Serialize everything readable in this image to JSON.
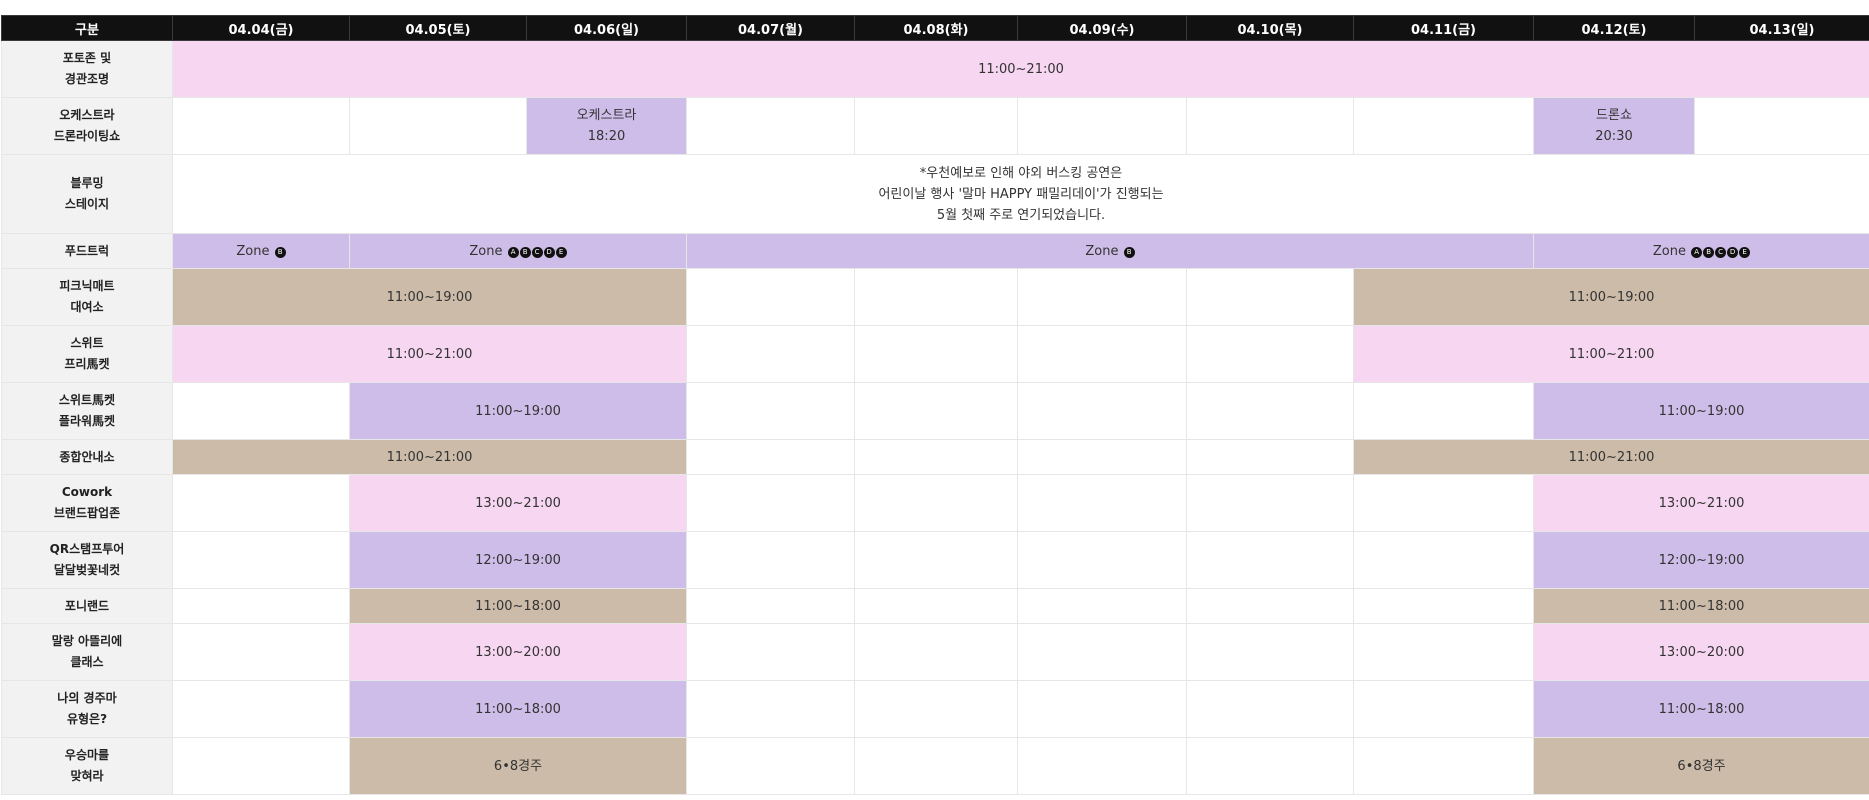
{
  "header": {
    "category": "구분",
    "dates": [
      "04.04(금)",
      "04.05(토)",
      "04.06(일)",
      "04.07(월)",
      "04.08(화)",
      "04.09(수)",
      "04.10(목)",
      "04.11(금)",
      "04.12(토)",
      "04.13(일)"
    ]
  },
  "rows": {
    "photozone": {
      "label1": "포토존 및",
      "label2": "경관조명",
      "time": "11:00~21:00"
    },
    "orchestra": {
      "label1": "오케스트라",
      "label2": "드론라이팅쇼",
      "ev1_name": "오케스트라",
      "ev1_time": "18:20",
      "ev2_name": "드론쇼",
      "ev2_time": "20:30"
    },
    "blooming": {
      "label1": "블루밍",
      "label2": "스테이지",
      "note1": "*우천예보로 인해 야외 버스킹 공연은",
      "note2": "어린이날 행사 '말마 HAPPY 패밀리데이'가 진행되는",
      "note3": "5월 첫째 주로 연기되었습니다."
    },
    "foodtruck": {
      "label": "푸드트럭",
      "zone_word": "Zone",
      "zone1_badges": [
        "B"
      ],
      "zone2_badges": [
        "A",
        "B",
        "C",
        "D",
        "E"
      ],
      "zone3_badges": [
        "B"
      ],
      "zone4_badges": [
        "A",
        "B",
        "C",
        "D",
        "E"
      ]
    },
    "picnic": {
      "label1": "피크닉매트",
      "label2": "대여소",
      "time_a": "11:00~19:00",
      "time_b": "11:00~19:00"
    },
    "sweet_free": {
      "label1": "스위트",
      "label2": "프리馬켓",
      "time_a": "11:00~21:00",
      "time_b": "11:00~21:00"
    },
    "flower": {
      "label1": "스위트馬켓",
      "label2": "플라워馬켓",
      "time_a": "11:00~19:00",
      "time_b": "11:00~19:00"
    },
    "info": {
      "label": "종합안내소",
      "time_a": "11:00~21:00",
      "time_b": "11:00~21:00"
    },
    "cowork": {
      "label1": "Cowork",
      "label2": "브랜드팝업존",
      "time_a": "13:00~21:00",
      "time_b": "13:00~21:00"
    },
    "qr": {
      "label1": "QR스탬프투어",
      "label2": "달달벚꽃네컷",
      "time_a": "12:00~19:00",
      "time_b": "12:00~19:00"
    },
    "pony": {
      "label": "포니랜드",
      "time_a": "11:00~18:00",
      "time_b": "11:00~18:00"
    },
    "atelier": {
      "label1": "말랑 아뜰리에",
      "label2": "클래스",
      "time_a": "13:00~20:00",
      "time_b": "13:00~20:00"
    },
    "racehorse": {
      "label1": "나의 경주마",
      "label2": "유형은?",
      "time_a": "11:00~18:00",
      "time_b": "11:00~18:00"
    },
    "winner": {
      "label1": "우승마를",
      "label2": "맞혀라",
      "time_a": "6•8경주",
      "time_b": "6•8경주"
    }
  }
}
